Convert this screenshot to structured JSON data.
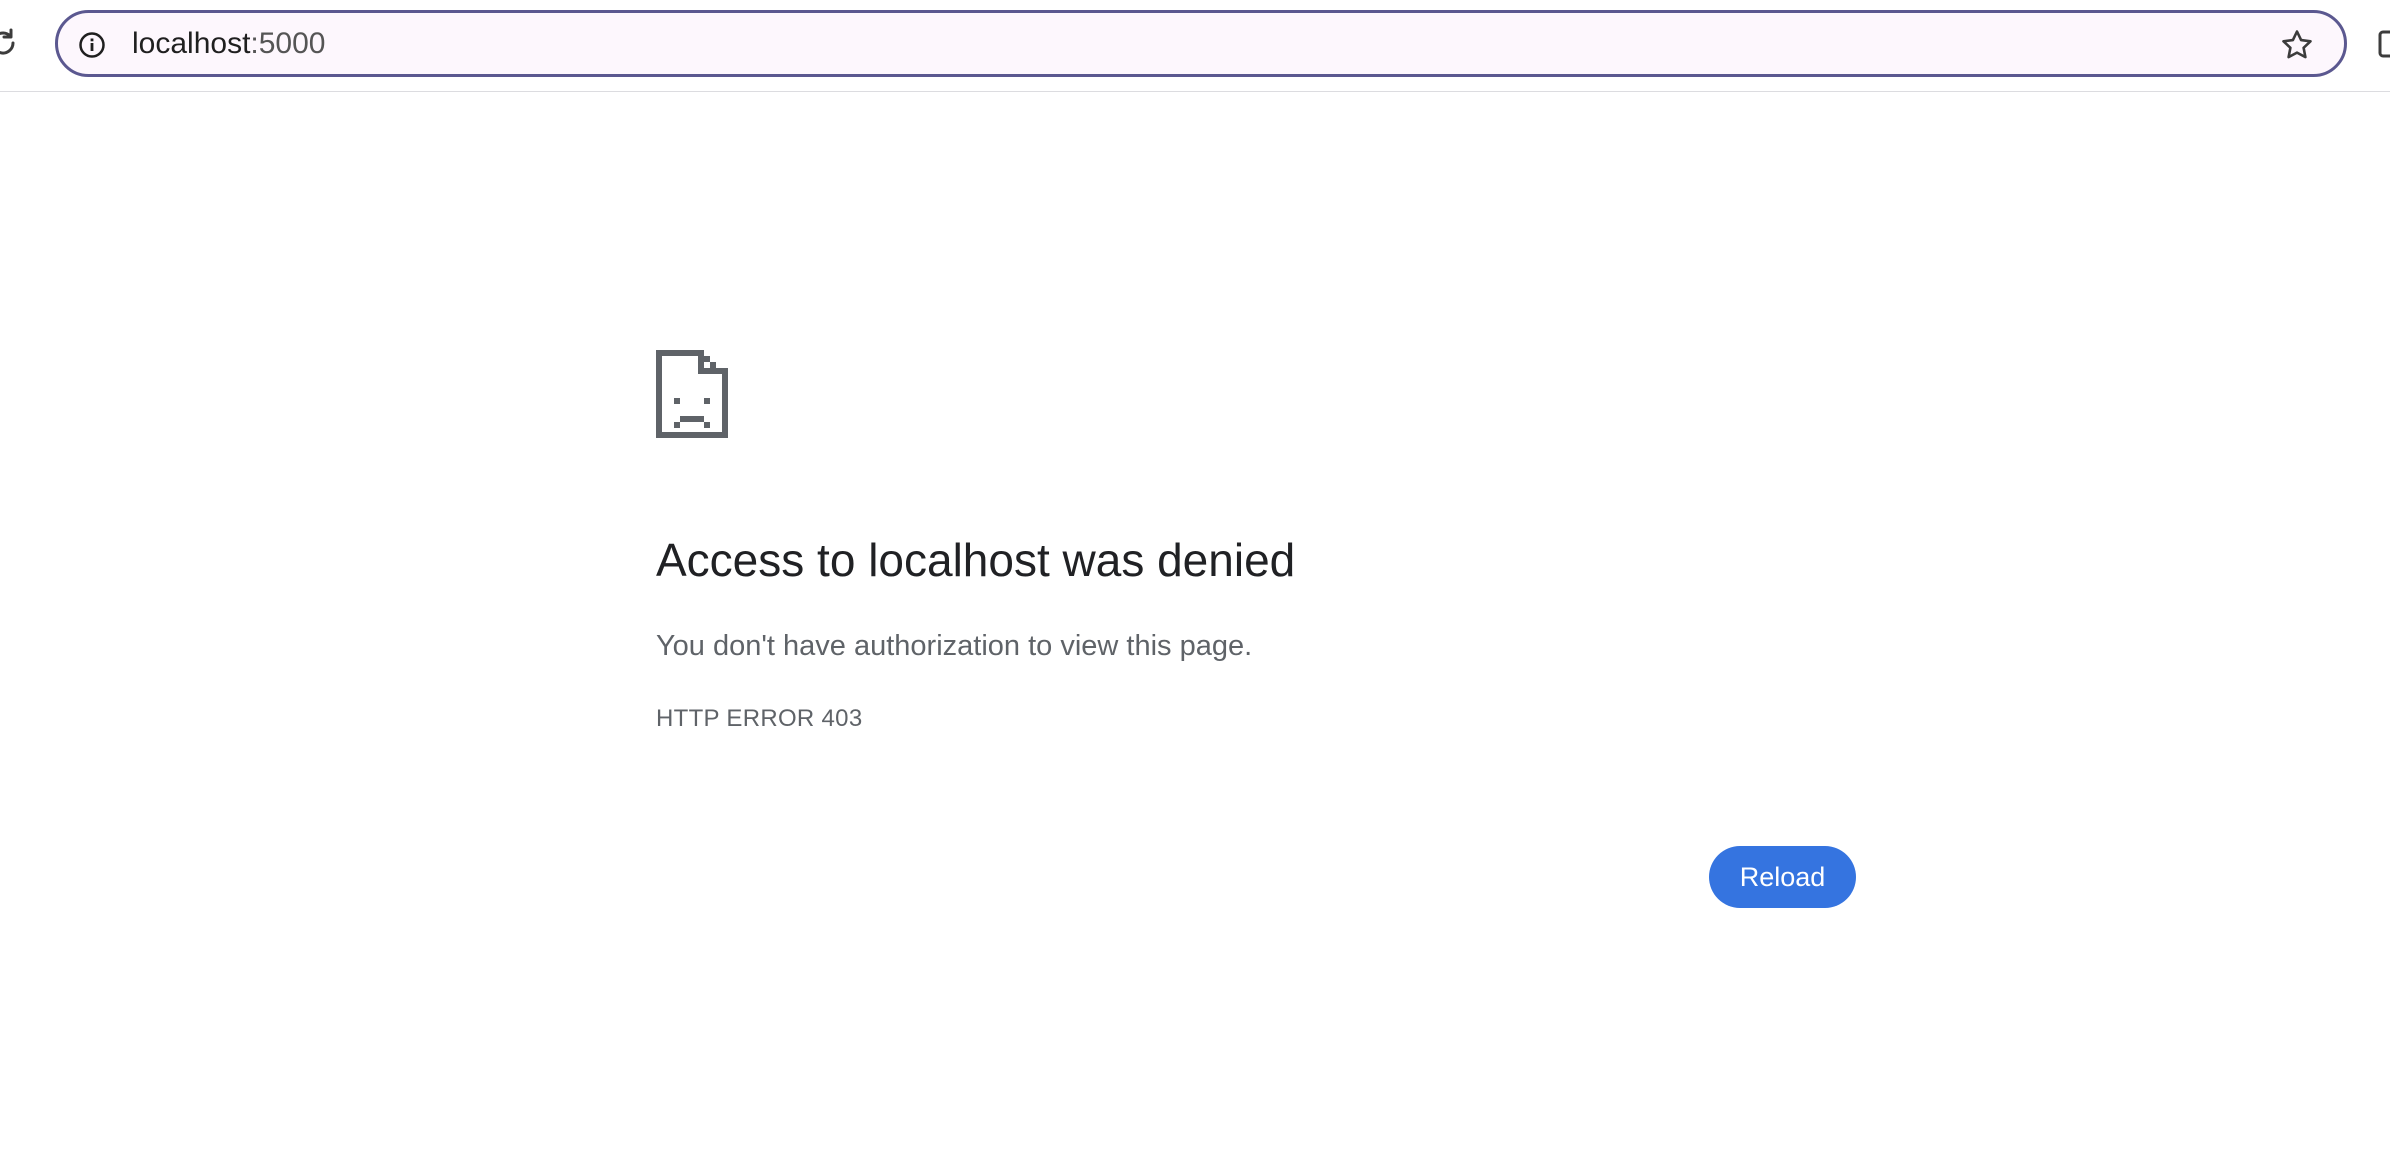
{
  "browser": {
    "url_host": "localhost",
    "url_port": ":5000",
    "icons": {
      "reload": "reload-icon",
      "site_info": "info-icon",
      "bookmark": "star-icon",
      "side_panel": "side-panel-icon"
    },
    "accent_color": "#5b5890"
  },
  "error_page": {
    "icon": "sad-file-icon",
    "title": "Access to localhost was denied",
    "message": "You don't have authorization to view this page.",
    "code": "HTTP ERROR 403",
    "reload_label": "Reload",
    "button_color": "#3574e0"
  }
}
